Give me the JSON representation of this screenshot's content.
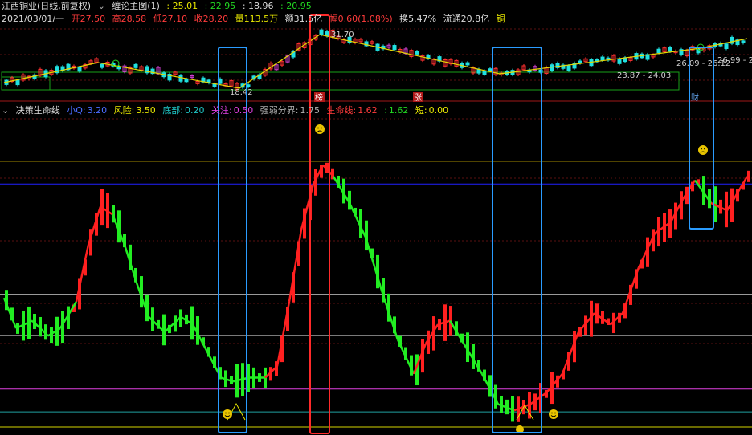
{
  "header": {
    "stock": "江西铜业(日线,前复权)",
    "indicator": "缠论主图(1)",
    "indicator_values": [
      ": 25.01",
      ": 22.95",
      ": 18.96",
      ": 20.95"
    ],
    "date": "2021/03/01/一",
    "open": "开27.50",
    "high": "高28.58",
    "low": "低27.10",
    "close": "收28.20",
    "volume": "量113.5万",
    "amount": "额31.5亿",
    "change": "幅0.60(1.08%)",
    "turnover": "换5.47%",
    "float": "流通20.8亿",
    "sector": "铜"
  },
  "lower": {
    "name": "决策生命线",
    "items": [
      {
        "label": "小Q:",
        "value": "3.20"
      },
      {
        "label": "风险:",
        "value": "3.50"
      },
      {
        "label": "底部:",
        "value": "0.20"
      },
      {
        "label": "关注:",
        "value": "0.50"
      },
      {
        "label": "强弱分界:",
        "value": "1.75"
      },
      {
        "label": "生命线:",
        "value": "1.62"
      },
      {
        "label": ":",
        "value": "1.62"
      },
      {
        "label": "短:",
        "value": "0.00"
      }
    ]
  },
  "colors": {
    "up": "#ff2020",
    "down": "#22ee22",
    "box_blue": "#2a9cff",
    "box_red": "#ff2a2a"
  },
  "chart_data": {
    "type": "bar",
    "upper": {
      "zigzag": [
        {
          "x": 5,
          "y": 103
        },
        {
          "x": 122,
          "y": 78
        },
        {
          "x": 298,
          "y": 110
        },
        {
          "x": 398,
          "y": 43
        },
        {
          "x": 622,
          "y": 92
        },
        {
          "x": 872,
          "y": 60
        },
        {
          "x": 930,
          "y": 48
        }
      ],
      "labels": [
        "18.42",
        "31.70",
        "23.87 - 24.03",
        "26.09 - 26.12",
        "26.99 - 2",
        "榜",
        "涨",
        "财"
      ]
    },
    "lower": {
      "ylim": [
        0,
        3.7
      ],
      "levels": [
        {
          "name": "风险",
          "value": 3.5,
          "color": "#d4b400"
        },
        {
          "name": "小Q",
          "value": 3.2,
          "color": "#2020ff"
        },
        {
          "name": "强弱分界",
          "value": 1.75,
          "color": "#9a9a9a"
        },
        {
          "name": "生命线",
          "value": 1.2,
          "color": "#7a7a7a"
        },
        {
          "name": "底部",
          "value": 0.2,
          "color": "#20a0a0"
        },
        {
          "name": "关注",
          "value": 0.5,
          "color": "#e040e0"
        },
        {
          "name": "短",
          "value": 0.0,
          "color": "#d4d400"
        }
      ],
      "line": [
        {
          "x": 5,
          "y": 1.7
        },
        {
          "x": 20,
          "y": 1.3
        },
        {
          "x": 40,
          "y": 1.4
        },
        {
          "x": 60,
          "y": 1.2
        },
        {
          "x": 75,
          "y": 1.3
        },
        {
          "x": 95,
          "y": 1.65
        },
        {
          "x": 110,
          "y": 2.4
        },
        {
          "x": 125,
          "y": 2.9
        },
        {
          "x": 140,
          "y": 2.8
        },
        {
          "x": 155,
          "y": 2.4
        },
        {
          "x": 170,
          "y": 1.9
        },
        {
          "x": 185,
          "y": 1.45
        },
        {
          "x": 205,
          "y": 1.25
        },
        {
          "x": 225,
          "y": 1.45
        },
        {
          "x": 240,
          "y": 1.35
        },
        {
          "x": 260,
          "y": 0.95
        },
        {
          "x": 275,
          "y": 0.65
        },
        {
          "x": 290,
          "y": 0.6
        },
        {
          "x": 310,
          "y": 0.65
        },
        {
          "x": 330,
          "y": 0.65
        },
        {
          "x": 345,
          "y": 0.8
        },
        {
          "x": 360,
          "y": 1.65
        },
        {
          "x": 375,
          "y": 2.6
        },
        {
          "x": 390,
          "y": 3.2
        },
        {
          "x": 402,
          "y": 3.45
        },
        {
          "x": 415,
          "y": 3.3
        },
        {
          "x": 435,
          "y": 2.95
        },
        {
          "x": 455,
          "y": 2.5
        },
        {
          "x": 475,
          "y": 1.8
        },
        {
          "x": 495,
          "y": 1.15
        },
        {
          "x": 515,
          "y": 0.7
        },
        {
          "x": 530,
          "y": 1.1
        },
        {
          "x": 545,
          "y": 1.35
        },
        {
          "x": 560,
          "y": 1.4
        },
        {
          "x": 580,
          "y": 1.05
        },
        {
          "x": 600,
          "y": 0.7
        },
        {
          "x": 620,
          "y": 0.3
        },
        {
          "x": 640,
          "y": 0.22
        },
        {
          "x": 660,
          "y": 0.3
        },
        {
          "x": 680,
          "y": 0.45
        },
        {
          "x": 700,
          "y": 0.7
        },
        {
          "x": 720,
          "y": 1.25
        },
        {
          "x": 740,
          "y": 1.5
        },
        {
          "x": 760,
          "y": 1.35
        },
        {
          "x": 775,
          "y": 1.5
        },
        {
          "x": 795,
          "y": 2.1
        },
        {
          "x": 815,
          "y": 2.55
        },
        {
          "x": 835,
          "y": 2.7
        },
        {
          "x": 850,
          "y": 3.0
        },
        {
          "x": 865,
          "y": 3.25
        },
        {
          "x": 885,
          "y": 2.95
        },
        {
          "x": 905,
          "y": 2.85
        },
        {
          "x": 930,
          "y": 3.3
        }
      ],
      "red_segments": [
        [
          90,
          135
        ],
        [
          335,
          412
        ],
        [
          520,
          565
        ],
        [
          640,
          870
        ],
        [
          895,
          932
        ]
      ]
    },
    "boxes": [
      {
        "x1": 272,
        "x2": 307,
        "color": "blue"
      },
      {
        "x1": 386,
        "x2": 410,
        "color": "red"
      },
      {
        "x1": 613,
        "x2": 674,
        "color": "blue"
      },
      {
        "x1": 858,
        "x2": 888,
        "color": "blue"
      }
    ]
  }
}
